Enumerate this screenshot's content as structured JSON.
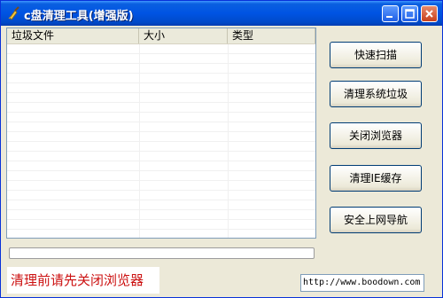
{
  "window": {
    "title": "c盘清理工具(增强版)",
    "icon": "broom-icon"
  },
  "file_list": {
    "columns": [
      "垃圾文件",
      "大小",
      "类型"
    ],
    "rows": []
  },
  "progress": {
    "value": 0
  },
  "actions": {
    "quick_scan": "快速扫描",
    "clean_system_junk": "清理系统垃圾",
    "close_browser": "关闭浏览器",
    "clean_ie_cache": "清理IE缓存",
    "safe_browsing_nav": "安全上网导航"
  },
  "notice": "清理前请先关闭浏览器",
  "url_field": {
    "value": "http://www.boodown.com"
  },
  "colors": {
    "notice_text": "#cc1111",
    "titlebar": "#0054e3"
  }
}
